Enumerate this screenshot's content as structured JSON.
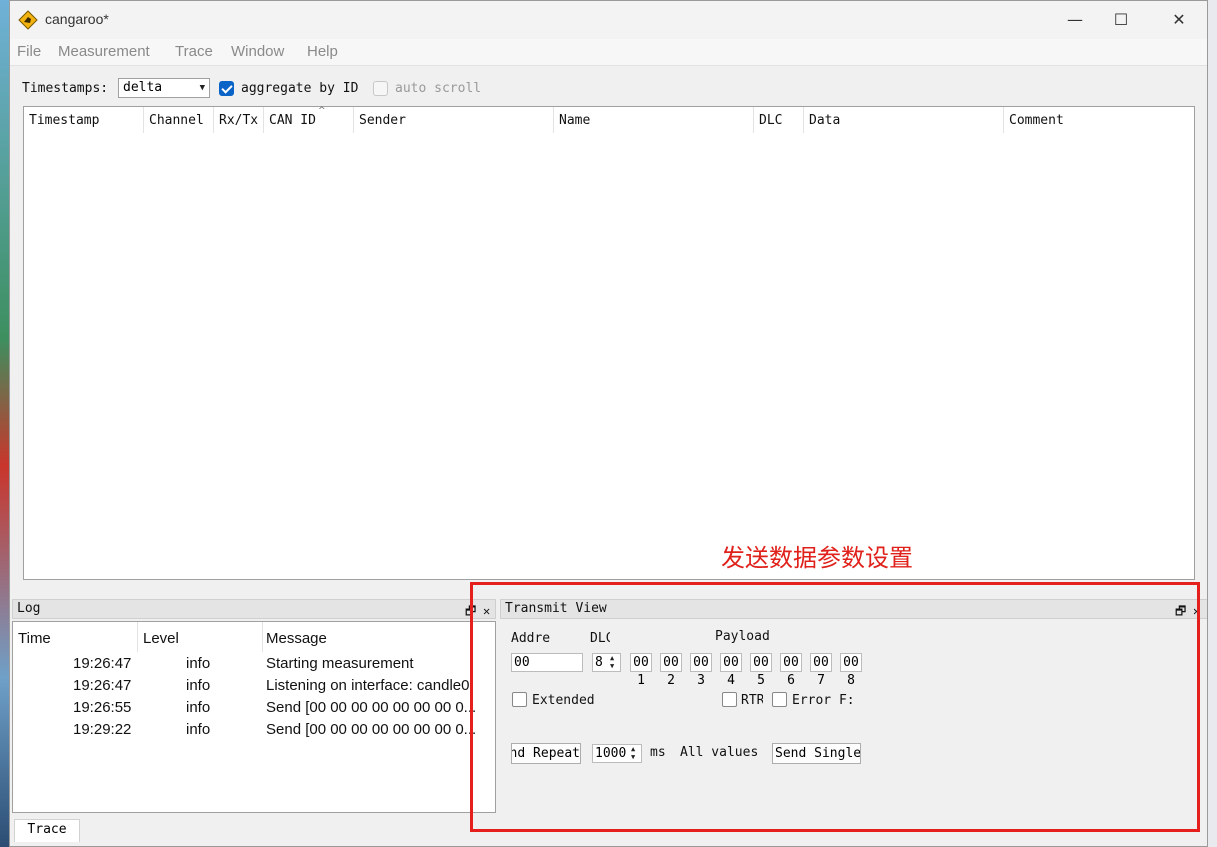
{
  "app": {
    "title": "cangaroo*"
  },
  "window_controls": {
    "minimize": "—",
    "maximize": "☐",
    "close": "✕"
  },
  "menu": [
    "File",
    "Measurement",
    "Trace",
    "Window",
    "Help"
  ],
  "toolbar": {
    "timestamps_label": "Timestamps:",
    "timestamps_value": "delta",
    "aggregate_label": "aggregate by ID",
    "aggregate_checked": true,
    "autoscroll_label": "auto scroll",
    "autoscroll_checked": false
  },
  "trace_table": {
    "columns": [
      "Timestamp",
      "Channel",
      "Rx/Tx",
      "CAN ID",
      "Sender",
      "Name",
      "DLC",
      "Data",
      "Comment"
    ],
    "rows": []
  },
  "annotation": {
    "text": "发送数据参数设置",
    "color": "#e0201a"
  },
  "log": {
    "title": "Log",
    "columns": [
      "Time",
      "Level",
      "Message"
    ],
    "rows": [
      {
        "time": "19:26:47",
        "level": "info",
        "message": "Starting measurement"
      },
      {
        "time": "19:26:47",
        "level": "info",
        "message": "Listening on interface: candle0"
      },
      {
        "time": "19:26:55",
        "level": "info",
        "message": "Send [00 00 00 00 00 00 00 0..."
      },
      {
        "time": "19:29:22",
        "level": "info",
        "message": "Send [00 00 00 00 00 00 00 0..."
      }
    ]
  },
  "transmit": {
    "title": "Transmit View",
    "address_label": "Addre",
    "address_value": "00",
    "dlc_label": "DLC",
    "dlc_value": "8",
    "payload_label": "Payload",
    "payload_bytes": [
      "00",
      "00",
      "00",
      "00",
      "00",
      "00",
      "00",
      "00"
    ],
    "byte_numbers": [
      "1",
      "2",
      "3",
      "4",
      "5",
      "6",
      "7",
      "8"
    ],
    "extended_label": "Extended",
    "rtr_label": "RTR",
    "error_label": "Error F:",
    "send_repeat_label": "Send Repeat",
    "interval_value": "1000",
    "interval_unit": "ms",
    "all_values_label": "All values",
    "send_single_label": "Send Single"
  },
  "bottom_tabs": [
    "Trace"
  ],
  "dock_controls": {
    "float": "🗗",
    "close": "✕"
  },
  "colors": {
    "highlight_border": "#e5201c",
    "checkbox_checked": "#0a64c8"
  }
}
